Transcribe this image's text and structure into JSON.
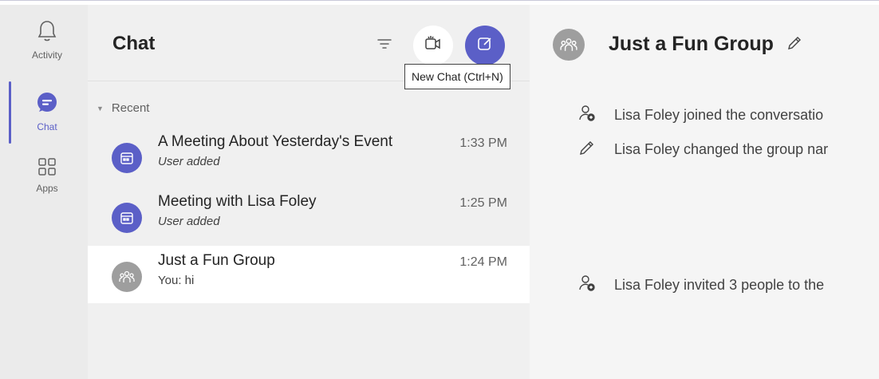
{
  "rail": {
    "items": [
      {
        "label": "Activity",
        "icon": "bell-icon"
      },
      {
        "label": "Chat",
        "icon": "chat-icon",
        "active": true
      },
      {
        "label": "Apps",
        "icon": "apps-icon"
      }
    ]
  },
  "chat_list": {
    "title": "Chat",
    "tooltip": "New Chat (Ctrl+N)",
    "section": "Recent",
    "rows": [
      {
        "name": "A Meeting About Yesterday's Event",
        "subtitle": "User added",
        "time": "1:33 PM",
        "icon": "meeting-icon"
      },
      {
        "name": "Meeting with Lisa Foley",
        "subtitle": "User added",
        "time": "1:25 PM",
        "icon": "meeting-icon"
      },
      {
        "name": "Just a Fun Group",
        "subtitle": "You: hi",
        "time": "1:24 PM",
        "icon": "group-icon",
        "selected": true
      }
    ]
  },
  "conversation": {
    "title": "Just a Fun Group",
    "events": [
      {
        "text": "Lisa Foley joined the conversatio",
        "icon": "person-add-icon"
      },
      {
        "text": "Lisa Foley changed the group nar",
        "icon": "pencil-icon"
      },
      {
        "text": "Lisa Foley invited 3 people to the",
        "icon": "person-add-icon"
      }
    ]
  },
  "colors": {
    "accent": "#5b5fc7",
    "group_avatar": "#9e9e9e"
  }
}
